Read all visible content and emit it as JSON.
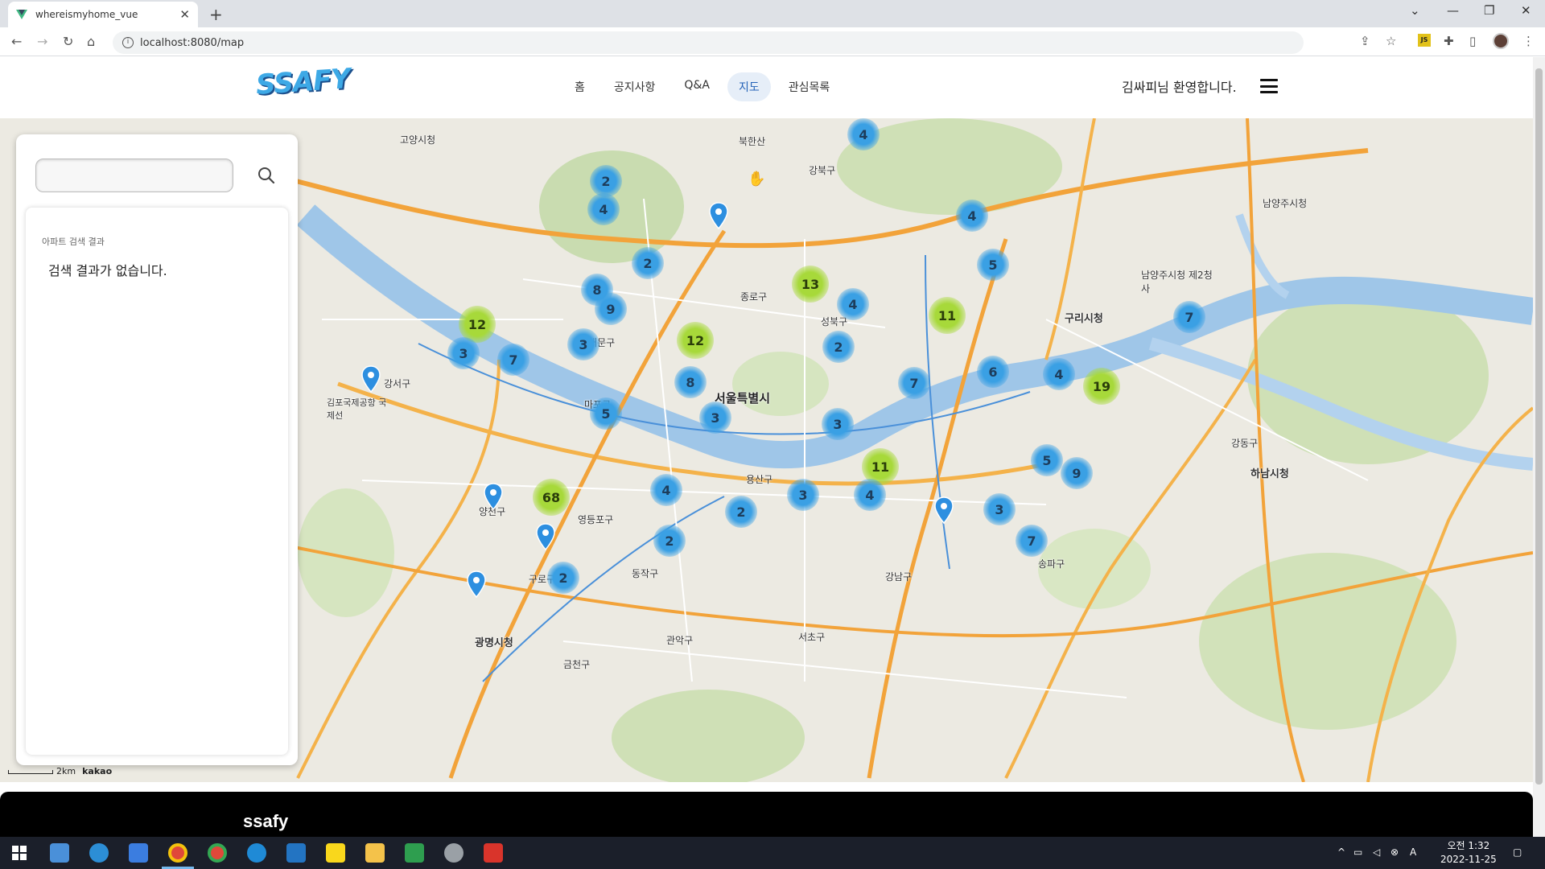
{
  "browser": {
    "tab_title": "whereismyhome_vue",
    "url": "localhost:8080/map"
  },
  "header": {
    "logo": "SSAFY",
    "menu": [
      {
        "label": "홈"
      },
      {
        "label": "공지사항"
      },
      {
        "label": "Q&A"
      },
      {
        "label": "지도",
        "active": true
      },
      {
        "label": "관심목록"
      }
    ],
    "welcome": "김싸피님 환영합니다."
  },
  "search": {
    "input_value": "",
    "results_title": "아파트 검색 결과",
    "empty_message": "검색 결과가 없습니다."
  },
  "map": {
    "labels": {
      "seoul": "서울특별시",
      "goyang": "고양시청",
      "guri": "구리시청",
      "hanam": "하남시청",
      "gwangmyeong": "광명시청",
      "namyangju": "남양주시청",
      "namyangju2": "남양주시청 제2청사",
      "gimpo_airport": "김포국제공항 국제선",
      "bukhansan": "북한산",
      "gangseo": "강서구",
      "mapo": "마포구",
      "jongno": "종로구",
      "seongbuk": "성북구",
      "yongsan": "용산구",
      "gangnam": "강남구",
      "seocho": "서초구",
      "songpa": "송파구",
      "guro": "구로구",
      "geumcheon": "금천구",
      "gwanak": "관악구",
      "dongjak": "동작구",
      "gangdong": "강동구",
      "yangcheon": "양천구",
      "yeongdeungpo": "영등포구",
      "seodaemun": "서대문구",
      "gangbuk": "강북구"
    },
    "clusters": [
      "4",
      "2",
      "4",
      "2",
      "4",
      "13",
      "5",
      "8",
      "9",
      "4",
      "11",
      "12",
      "3",
      "7",
      "12",
      "2",
      "7",
      "3",
      "7",
      "8",
      "6",
      "4",
      "19",
      "5",
      "3",
      "3",
      "11",
      "5",
      "9",
      "4",
      "2",
      "68",
      "4",
      "3",
      "3",
      "7",
      "2",
      "2"
    ],
    "scale_text": "2km",
    "attribution": "kakao"
  },
  "footer": {
    "title": "ssafy"
  },
  "taskbar": {
    "time": "오전 1:32",
    "date": "2022-11-25"
  }
}
